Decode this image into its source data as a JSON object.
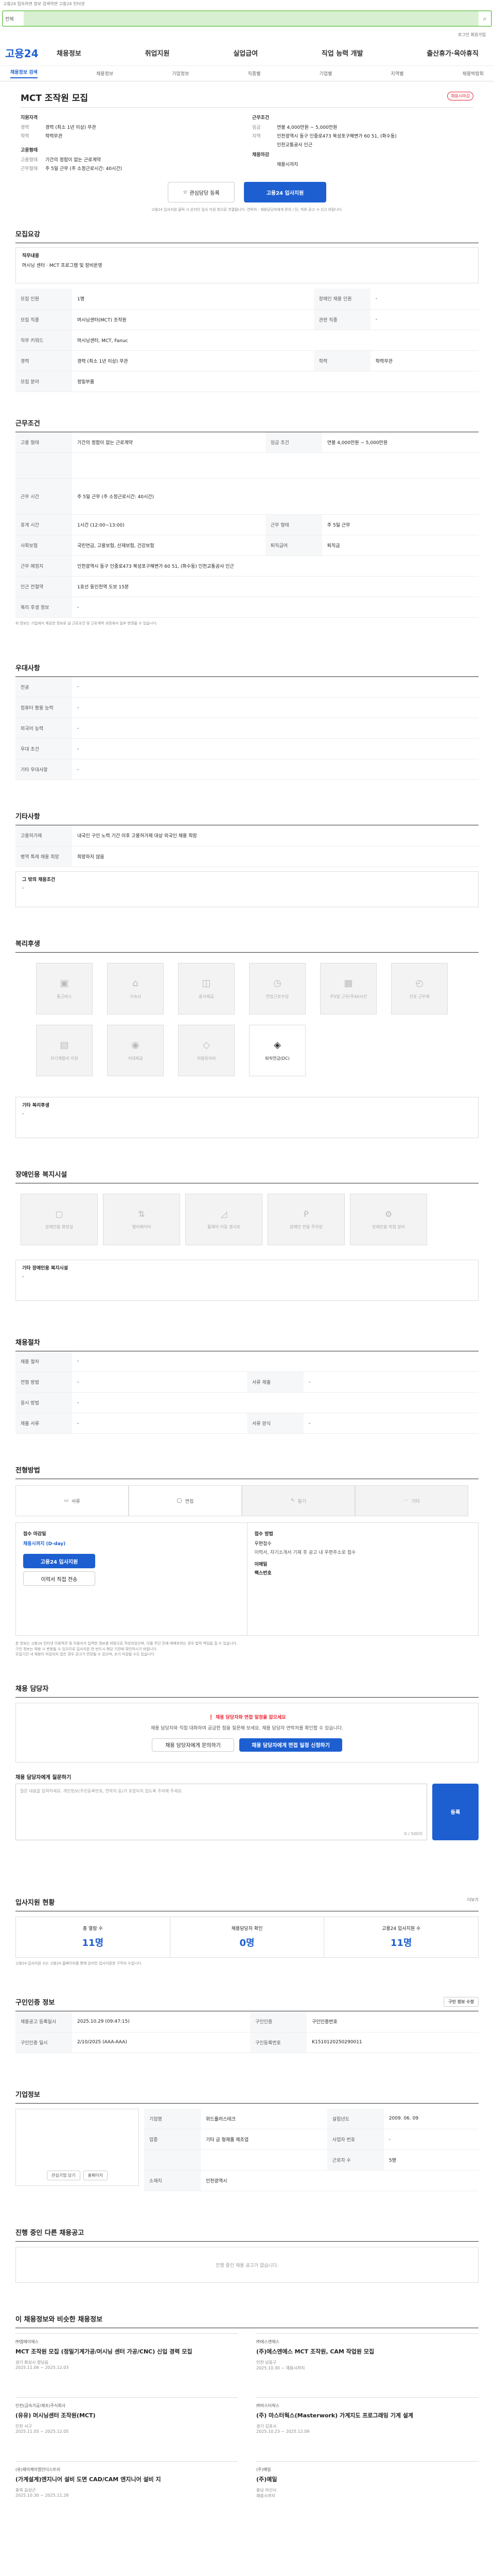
{
  "topbar": {
    "text": "고용24 접속하면 정보 검색하면 고용24 인터넷"
  },
  "search": {
    "scope": "전체",
    "placeholder": ""
  },
  "util_links": "로그인  회원가입",
  "gnb": {
    "logo": "고용24",
    "menu": [
      "채용정보",
      "취업지원",
      "실업급여",
      "직업 능력 개발",
      "출산휴가·육아휴직"
    ]
  },
  "lnb": {
    "items": [
      "채용정보 검색",
      "채용정보",
      "기업정보",
      "직종별",
      "기업별",
      "지역별",
      "채용박람회"
    ],
    "active": 0
  },
  "job": {
    "title": "MCT 조작원 모집",
    "badge": "채용시마감"
  },
  "company": {
    "label": "지원자격",
    "rows": [
      [
        "경력",
        "경력 (최소 1년 이상) 무관"
      ],
      [
        "학력",
        "학력무관"
      ]
    ]
  },
  "conditions": {
    "label": "근무조건",
    "rows": [
      [
        "임금",
        "연봉 4,000만원 ~ 5,000만원"
      ],
      [
        "지역",
        "인천광역시 동구 인중로473 북성포구해변가 60 51, (화수동)"
      ],
      [
        "",
        "인천교통공사 인근"
      ]
    ]
  },
  "employ": {
    "label": "고용형태",
    "rows": [
      [
        "고용형태",
        "기간의 정함이 없는 근로계약"
      ],
      [
        "근무형태",
        "주 5일 근무 (주 소정근로시간: 40시간)"
      ]
    ]
  },
  "deadline": {
    "label": "채용마감",
    "rows": [
      [
        "",
        "채용시까지"
      ]
    ]
  },
  "actions": {
    "scrap": "관심담당 등록",
    "apply": "고용24 입사지원"
  },
  "notice": "고용24 입사지원 클릭 시 온라인 입사 지원 창으로 연결됩니다. 연락처 : 채용담당자에게 문의 / 단, 허위 공고 시 신고 바랍니다.",
  "sec_recruit": {
    "title": "모집요강",
    "duty_label": "직무내용",
    "duty_text": "머시닝 센터 · MCT 프로그램 및 장비운영",
    "rows": [
      [
        "모집 인원",
        "1명",
        "장애인 채용 인원",
        "-"
      ],
      [
        "모집 직종",
        "머시닝센터(MCT) 조작원",
        "관련 직종",
        "-"
      ],
      [
        "직무 키워드",
        "머시닝센터, MCT, Fanuc",
        "",
        ""
      ],
      [
        "경력",
        "경력 (최소 1년 이상) 무관",
        "학력",
        "학력무관"
      ],
      [
        "모집 분야",
        "정밀부품",
        "",
        ""
      ]
    ]
  },
  "sec_work": {
    "title": "근무조건",
    "rows": [
      [
        "고용 형태",
        "기간의 정함이 없는 근로계약",
        "임금 조건",
        "연봉 4,000만원 ~ 5,000만원"
      ],
      [
        "",
        "",
        "",
        ""
      ],
      [
        "근무 시간",
        "주 5일 근무 (주 소정근로시간: 40시간)",
        "",
        ""
      ],
      [
        "",
        "",
        "",
        ""
      ],
      [
        "휴게 시간",
        "1시간 (12:00~13:00)",
        "근무 형태",
        "주 5일 근무"
      ],
      [
        "사회보험",
        "국민연금, 고용보험, 산재보험, 건강보험",
        "퇴직급여",
        "퇴직금"
      ],
      [
        "근무 예정지",
        "인천광역시 동구 인중로473 북성포구해변가 60 51, (화수동) 인천교통공사 인근",
        "",
        ""
      ],
      [
        "인근 전철역",
        "1호선 동인천역 도보 15분",
        "",
        ""
      ],
      [
        "복리 후생 정보",
        "-",
        "",
        ""
      ]
    ],
    "note": "위 정보는 기업에서 제공한 정보로 실 근로조건 및 근로계약 과정에서 일부 변경될 수 있습니다."
  },
  "sec_pref": {
    "title": "우대사항",
    "rows": [
      [
        "전공",
        "-"
      ],
      [
        "컴퓨터 활용 능력",
        "-"
      ],
      [
        "외국어 능력",
        "-"
      ],
      [
        "우대 조건",
        "-"
      ],
      [
        "기타 우대사항",
        "-"
      ]
    ]
  },
  "sec_etc": {
    "title": "기타사항",
    "rows": [
      [
        "고용허가제",
        "내국인 구인 노력 기간 이후 고용허가제 대상 외국인 채용 희망"
      ],
      [
        "병역 특례 채용 희망",
        "희망하지 않음"
      ]
    ],
    "etc_label": "그 밖의 채용조건",
    "etc_value": "-"
  },
  "sec_welfare": {
    "title": "복리후생",
    "items": [
      "통근버스",
      "기숙사",
      "중식제공",
      "연장근로수당",
      "주5일 근무/주40시간",
      "간호 근무제",
      "자기계발비 지원",
      "식대제공",
      "차량유지비",
      "퇴직연금(DC)"
    ],
    "active": [
      9
    ],
    "etc_label": "기타 복리후생",
    "etc_value": "-"
  },
  "sec_disabled": {
    "title": "장애인용 복지시설",
    "items": [
      "장애인용 화장실",
      "엘리베이터",
      "휠체어 이동 경사로",
      "장애인 전용 주차장",
      "장애인용 작업 장비"
    ],
    "etc_label": "기타 장애인용 복지시설",
    "etc_value": "-"
  },
  "sec_process": {
    "title": "채용절차",
    "rows": [
      [
        "채용 절차",
        "-",
        "",
        ""
      ],
      [
        "전형 방법",
        "-",
        "서류 제출",
        "-"
      ],
      [
        "응시 방법",
        "-",
        "",
        ""
      ],
      [
        "제출 서류",
        "-",
        "서류 양식",
        "-"
      ]
    ]
  },
  "sec_method": {
    "title": "전형방법",
    "items": [
      "서류",
      "면접",
      "필기",
      "기타"
    ],
    "active": [
      0,
      1
    ]
  },
  "sec_apply": {
    "col1_title": "접수 마감일",
    "col1_sub": "채용시까지 (D-day)",
    "col1_btn1": "고용24 입사지원",
    "col1_btn2": "이력서 직접 전송",
    "col2_title": "접수 방법",
    "col2_rows": [
      "우편접수",
      "이메일",
      "팩스번호"
    ],
    "col2_sub": "이력서, 자기소개서 기재 후 공고 내 우편주소로 접수",
    "notes": [
      "본 정보는 고용24 인터넷 이용약관 및 이용자가 입력한 정보를 바탕으로 작성되었으며, 이를 무단 전재·재배포하는 경우 법적 책임을 질 수 있습니다.",
      "구인 정보는 채용 시 변동될 수 있으므로 입사지원 전 반드시 해당 기관에 확인하시기 바랍니다.",
      "모집기간 내 채용이 마감되지 않은 경우 공고가 연장될 수 있으며, 조기 마감될 수도 있습니다."
    ]
  },
  "sec_talk": {
    "title": "채용 담당자",
    "badge": "채용 담당자와 면접 일정을 잡으세요",
    "desc": "채용 담당자와 직접 대화하여 궁금한 점을 질문해 보세요. 채용 담당자 연락처를 확인할 수 있습니다.",
    "btn1": "채용 담당자에게 문의하기",
    "btn2": "채용 담당자에게 면접 일정 신청하기",
    "q_label": "채용 담당자에게 질문하기",
    "q_placeholder": "질문 내용을 입력하세요. 개인정보(주민등록번호, 연락처 등)가 포함되지 않도록 주의해 주세요.",
    "q_count": "0 / 500자",
    "q_btn": "등록"
  },
  "sec_stats": {
    "title": "입사지원 현황",
    "link": "더보기",
    "items": [
      [
        "총 열람 수",
        "11명"
      ],
      [
        "채용담당자 확인",
        "0명"
      ],
      [
        "고용24 입사지원 수",
        "11명"
      ]
    ],
    "note": "고용24 입사지원 수는 고용24 홈페이지를 통해 온라인 입사지원한 구직자 수입니다."
  },
  "sec_info": {
    "title": "구인인증 정보",
    "rows": [
      [
        "채용공고 등록일시",
        "2025.10.29 (09:47:15)",
        "구인인증",
        "구인인증번호"
      ],
      [
        "구인인증 일시",
        "2/10/2025 (AAA-AAA)",
        "구인등록번호",
        "K1510120250290011"
      ]
    ],
    "link": "구인 정보 수정"
  },
  "sec_company": {
    "title": "기업정보",
    "rows": [
      [
        "기업명",
        "위드플러스테크",
        "설립년도",
        "2009. 06. 09"
      ],
      [
        "업종",
        "기타 금 형제품 제조업",
        "사업자 번호",
        "-"
      ],
      [
        "",
        "",
        "근로자 수",
        "5명"
      ],
      [
        "소재지",
        "인천광역시",
        "",
        ""
      ]
    ],
    "btn1": "관심기업 담기",
    "btn2": "홈페이지"
  },
  "sec_other": {
    "title": "진행 중인 다른 채용공고",
    "empty": "진행 중인 채용 공고가 없습니다."
  },
  "sec_reco": {
    "title": "이 채용정보와 비슷한 채용정보",
    "items": [
      {
        "co": "㈜엠에이에스",
        "t": "MCT 조작원 모집 (정밀기계가공/머시닝 센터 가공/CNC) 신입 경력 모집",
        "m": "경기 화성시 향남읍",
        "d": "2025.11.06 ~ 2025.12.03"
      },
      {
        "co": "㈜에스엔에스",
        "t": "(주)에스엔에스 MCT 조작원, CAM 작업원 모집",
        "m": "인천 남동구",
        "d": "2025.10.30 ~ 채용시까지"
      },
      {
        "co": "인천(금속가공/제조)주식회사",
        "t": "(유유) 머시닝센터 조작원(MCT)",
        "m": "인천 서구",
        "d": "2025.11.05 ~ 2025.12.05"
      },
      {
        "co": "㈜마스터웍스",
        "t": "(주) 마스터웍스(Masterwork) 가계지도 프로그래밍 기계 설계",
        "m": "경기 김포시",
        "d": "2025.10.23 ~ 2025.12.09"
      },
      {
        "co": "(유)제이케이엠인더스트리",
        "t": "(가계설계)엔지니어 설비 도면 CAD/CAM 엔지니어 설비 지",
        "m": "충북 음성군",
        "d": "2025.10.30 ~ 2025.11.28"
      },
      {
        "co": "(주)예일",
        "t": "(주)예일",
        "m": "충남 아산시",
        "d": "채용시까지"
      }
    ]
  }
}
